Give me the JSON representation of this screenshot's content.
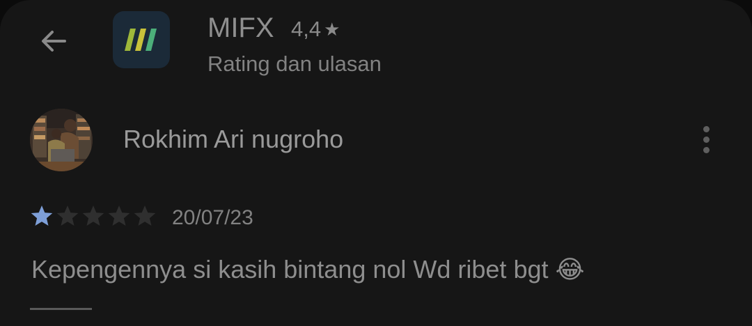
{
  "header": {
    "app_name": "MIFX",
    "rating_value": "4,4",
    "rating_star_glyph": "★",
    "subtitle": "Rating dan ulasan",
    "back_icon": "arrow-left-icon",
    "app_icon": "mifx-logo-icon"
  },
  "review": {
    "author": "Rokhim Ari nugroho",
    "rating": 1,
    "max_rating": 5,
    "date": "20/07/23",
    "text": "Kepengennya si kasih bintang nol Wd ribet bgt 😂",
    "more_icon": "more-vert-icon"
  },
  "colors": {
    "background": "#161616",
    "star_filled": "#7e9fd8",
    "star_empty": "#2f2f2f",
    "text_primary": "#9a9a9a",
    "text_secondary": "#828282",
    "app_icon_bg": "#1b2a38"
  }
}
